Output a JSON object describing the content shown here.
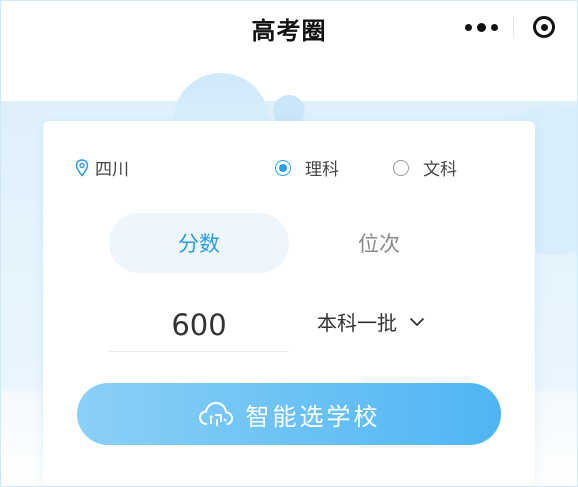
{
  "header": {
    "title": "高考圈",
    "more_icon": "more-dots-icon",
    "close_icon": "miniprogram-close-icon"
  },
  "form": {
    "location": "四川",
    "location_icon": "map-pin-icon",
    "subject_options": [
      {
        "label": "理科",
        "selected": true
      },
      {
        "label": "文科",
        "selected": false
      }
    ],
    "tabs": [
      {
        "label": "分数",
        "active": true
      },
      {
        "label": "位次",
        "active": false
      }
    ],
    "score_value": "600",
    "batch_value": "本科一批",
    "batch_icon": "chevron-down-icon",
    "cta_label": "智能选学校",
    "cta_icon": "cloud-icon"
  },
  "colors": {
    "accent": "#2a9de0",
    "cta_start": "#8bd0f7",
    "cta_end": "#4fb5f3",
    "band": "#dff0fb"
  }
}
